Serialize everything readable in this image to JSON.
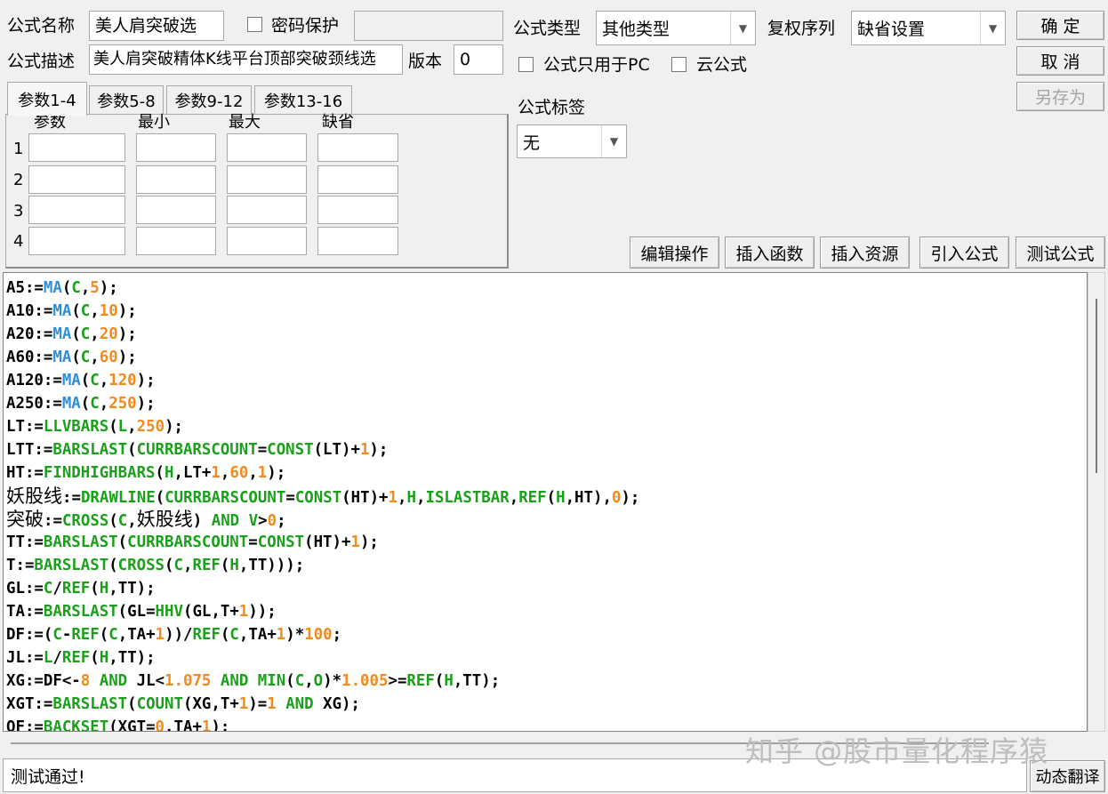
{
  "form": {
    "name_label": "公式名称",
    "name_value": "美人肩突破选",
    "password_label": "密码保护",
    "password_value": "",
    "desc_label": "公式描述",
    "desc_value": "美人肩突破精体K线平台顶部突破颈线选",
    "version_label": "版本",
    "version_value": "0",
    "type_label": "公式类型",
    "type_value": "其他类型",
    "rights_label": "复权序列",
    "rights_value": "缺省设置",
    "pc_only_label": "公式只用于PC",
    "cloud_label": "云公式",
    "tag_label": "公式标签",
    "tag_value": "无"
  },
  "buttons": {
    "ok": "确 定",
    "cancel": "取 消",
    "save_as": "另存为",
    "edit_ops": "编辑操作",
    "insert_func": "插入函数",
    "insert_res": "插入资源",
    "import_formula": "引入公式",
    "test_formula": "测试公式",
    "dyn_translate": "动态翻译"
  },
  "tabs": [
    "参数1-4",
    "参数5-8",
    "参数9-12",
    "参数13-16"
  ],
  "params": {
    "headers": [
      "参数",
      "最小",
      "最大",
      "缺省"
    ],
    "rows": [
      "1",
      "2",
      "3",
      "4"
    ]
  },
  "status_text": "测试通过!",
  "watermark": "知乎 @股市量化程序猿",
  "colors": {
    "number": "#f28a1e",
    "ma_func": "#2e8fd6",
    "func": "#1aa01a",
    "text": "#000000"
  },
  "code_lines": [
    [
      [
        "A5:=",
        "t"
      ],
      [
        "MA",
        "m"
      ],
      [
        "(",
        "t"
      ],
      [
        "C",
        "f"
      ],
      [
        ",",
        "t"
      ],
      [
        "5",
        "n"
      ],
      [
        ");",
        "t"
      ]
    ],
    [
      [
        "A10:=",
        "t"
      ],
      [
        "MA",
        "m"
      ],
      [
        "(",
        "t"
      ],
      [
        "C",
        "f"
      ],
      [
        ",",
        "t"
      ],
      [
        "10",
        "n"
      ],
      [
        ");",
        "t"
      ]
    ],
    [
      [
        "A20:=",
        "t"
      ],
      [
        "MA",
        "m"
      ],
      [
        "(",
        "t"
      ],
      [
        "C",
        "f"
      ],
      [
        ",",
        "t"
      ],
      [
        "20",
        "n"
      ],
      [
        ");",
        "t"
      ]
    ],
    [
      [
        "A60:=",
        "t"
      ],
      [
        "MA",
        "m"
      ],
      [
        "(",
        "t"
      ],
      [
        "C",
        "f"
      ],
      [
        ",",
        "t"
      ],
      [
        "60",
        "n"
      ],
      [
        ");",
        "t"
      ]
    ],
    [
      [
        "A120:=",
        "t"
      ],
      [
        "MA",
        "m"
      ],
      [
        "(",
        "t"
      ],
      [
        "C",
        "f"
      ],
      [
        ",",
        "t"
      ],
      [
        "120",
        "n"
      ],
      [
        ");",
        "t"
      ]
    ],
    [
      [
        "A250:=",
        "t"
      ],
      [
        "MA",
        "m"
      ],
      [
        "(",
        "t"
      ],
      [
        "C",
        "f"
      ],
      [
        ",",
        "t"
      ],
      [
        "250",
        "n"
      ],
      [
        ");",
        "t"
      ]
    ],
    [
      [
        "LT:=",
        "t"
      ],
      [
        "LLVBARS",
        "f"
      ],
      [
        "(",
        "t"
      ],
      [
        "L",
        "f"
      ],
      [
        ",",
        "t"
      ],
      [
        "250",
        "n"
      ],
      [
        ");",
        "t"
      ]
    ],
    [
      [
        "LTT:=",
        "t"
      ],
      [
        "BARSLAST",
        "f"
      ],
      [
        "(",
        "t"
      ],
      [
        "CURRBARSCOUNT",
        "f"
      ],
      [
        "=",
        "t"
      ],
      [
        "CONST",
        "f"
      ],
      [
        "(LT)+",
        "t"
      ],
      [
        "1",
        "n"
      ],
      [
        ");",
        "t"
      ]
    ],
    [
      [
        "HT:=",
        "t"
      ],
      [
        "FINDHIGHBARS",
        "f"
      ],
      [
        "(",
        "t"
      ],
      [
        "H",
        "f"
      ],
      [
        ",LT+",
        "t"
      ],
      [
        "1",
        "n"
      ],
      [
        ",",
        "t"
      ],
      [
        "60",
        "n"
      ],
      [
        ",",
        "t"
      ],
      [
        "1",
        "n"
      ],
      [
        ");",
        "t"
      ]
    ],
    [
      [
        "妖股线",
        "cn"
      ],
      [
        ":=",
        "t"
      ],
      [
        "DRAWLINE",
        "f"
      ],
      [
        "(",
        "t"
      ],
      [
        "CURRBARSCOUNT",
        "f"
      ],
      [
        "=",
        "t"
      ],
      [
        "CONST",
        "f"
      ],
      [
        "(HT)+",
        "t"
      ],
      [
        "1",
        "n"
      ],
      [
        ",",
        "t"
      ],
      [
        "H",
        "f"
      ],
      [
        ",",
        "t"
      ],
      [
        "ISLASTBAR",
        "f"
      ],
      [
        ",",
        "t"
      ],
      [
        "REF",
        "f"
      ],
      [
        "(",
        "t"
      ],
      [
        "H",
        "f"
      ],
      [
        ",HT),",
        "t"
      ],
      [
        "0",
        "n"
      ],
      [
        ");",
        "t"
      ]
    ],
    [
      [
        "突破",
        "cn"
      ],
      [
        ":=",
        "t"
      ],
      [
        "CROSS",
        "f"
      ],
      [
        "(",
        "t"
      ],
      [
        "C",
        "f"
      ],
      [
        ",",
        "t"
      ],
      [
        "妖股线",
        "cn"
      ],
      [
        ") ",
        "t"
      ],
      [
        "AND",
        "f"
      ],
      [
        " ",
        "t"
      ],
      [
        "V",
        "f"
      ],
      [
        ">",
        "t"
      ],
      [
        "0",
        "n"
      ],
      [
        ";",
        "t"
      ]
    ],
    [
      [
        "TT:=",
        "t"
      ],
      [
        "BARSLAST",
        "f"
      ],
      [
        "(",
        "t"
      ],
      [
        "CURRBARSCOUNT",
        "f"
      ],
      [
        "=",
        "t"
      ],
      [
        "CONST",
        "f"
      ],
      [
        "(HT)+",
        "t"
      ],
      [
        "1",
        "n"
      ],
      [
        ");",
        "t"
      ]
    ],
    [
      [
        "T:=",
        "t"
      ],
      [
        "BARSLAST",
        "f"
      ],
      [
        "(",
        "t"
      ],
      [
        "CROSS",
        "f"
      ],
      [
        "(",
        "t"
      ],
      [
        "C",
        "f"
      ],
      [
        ",",
        "t"
      ],
      [
        "REF",
        "f"
      ],
      [
        "(",
        "t"
      ],
      [
        "H",
        "f"
      ],
      [
        ",TT)));",
        "t"
      ]
    ],
    [
      [
        "GL:=",
        "t"
      ],
      [
        "C",
        "f"
      ],
      [
        "/",
        "t"
      ],
      [
        "REF",
        "f"
      ],
      [
        "(",
        "t"
      ],
      [
        "H",
        "f"
      ],
      [
        ",TT);",
        "t"
      ]
    ],
    [
      [
        "TA:=",
        "t"
      ],
      [
        "BARSLAST",
        "f"
      ],
      [
        "(GL=",
        "t"
      ],
      [
        "HHV",
        "f"
      ],
      [
        "(GL,T+",
        "t"
      ],
      [
        "1",
        "n"
      ],
      [
        "));",
        "t"
      ]
    ],
    [
      [
        "DF:=(",
        "t"
      ],
      [
        "C",
        "f"
      ],
      [
        "-",
        "t"
      ],
      [
        "REF",
        "f"
      ],
      [
        "(",
        "t"
      ],
      [
        "C",
        "f"
      ],
      [
        ",TA+",
        "t"
      ],
      [
        "1",
        "n"
      ],
      [
        "))/",
        "t"
      ],
      [
        "REF",
        "f"
      ],
      [
        "(",
        "t"
      ],
      [
        "C",
        "f"
      ],
      [
        ",TA+",
        "t"
      ],
      [
        "1",
        "n"
      ],
      [
        ")*",
        "t"
      ],
      [
        "100",
        "n"
      ],
      [
        ";",
        "t"
      ]
    ],
    [
      [
        "JL:=",
        "t"
      ],
      [
        "L",
        "f"
      ],
      [
        "/",
        "t"
      ],
      [
        "REF",
        "f"
      ],
      [
        "(",
        "t"
      ],
      [
        "H",
        "f"
      ],
      [
        ",TT);",
        "t"
      ]
    ],
    [
      [
        "XG:=DF<-",
        "t"
      ],
      [
        "8",
        "n"
      ],
      [
        " ",
        "t"
      ],
      [
        "AND",
        "f"
      ],
      [
        " JL<",
        "t"
      ],
      [
        "1.075",
        "n"
      ],
      [
        " ",
        "t"
      ],
      [
        "AND",
        "f"
      ],
      [
        " ",
        "t"
      ],
      [
        "MIN",
        "f"
      ],
      [
        "(",
        "t"
      ],
      [
        "C",
        "f"
      ],
      [
        ",",
        "t"
      ],
      [
        "O",
        "f"
      ],
      [
        ")*",
        "t"
      ],
      [
        "1.005",
        "n"
      ],
      [
        ">=",
        "t"
      ],
      [
        "REF",
        "f"
      ],
      [
        "(",
        "t"
      ],
      [
        "H",
        "f"
      ],
      [
        ",TT);",
        "t"
      ]
    ],
    [
      [
        "XGT:=",
        "t"
      ],
      [
        "BARSLAST",
        "f"
      ],
      [
        "(",
        "t"
      ],
      [
        "COUNT",
        "f"
      ],
      [
        "(XG,T+",
        "t"
      ],
      [
        "1",
        "n"
      ],
      [
        ")=",
        "t"
      ],
      [
        "1",
        "n"
      ],
      [
        " ",
        "t"
      ],
      [
        "AND",
        "f"
      ],
      [
        " XG);",
        "t"
      ]
    ],
    [
      [
        "OF:=",
        "t"
      ],
      [
        "BACKSET",
        "f"
      ],
      [
        "(XGT=",
        "t"
      ],
      [
        "0",
        "n"
      ],
      [
        ".TA+",
        "t"
      ],
      [
        "1",
        "n"
      ],
      [
        "):",
        "t"
      ]
    ]
  ]
}
